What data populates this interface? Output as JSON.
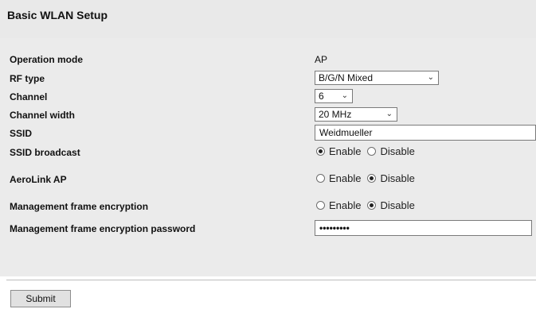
{
  "title": "Basic WLAN Setup",
  "fields": {
    "operation_mode": {
      "label": "Operation mode",
      "value": "AP"
    },
    "rf_type": {
      "label": "RF type",
      "value": "B/G/N Mixed"
    },
    "channel": {
      "label": "Channel",
      "value": "6"
    },
    "channel_width": {
      "label": "Channel width",
      "value": "20 MHz"
    },
    "ssid": {
      "label": "SSID",
      "value": "Weidmueller"
    },
    "ssid_broadcast": {
      "label": "SSID broadcast",
      "enable": "Enable",
      "disable": "Disable",
      "selected": "Enable"
    },
    "aerolink_ap": {
      "label": "AeroLink AP",
      "enable": "Enable",
      "disable": "Disable",
      "selected": "Disable"
    },
    "mgmt_frame_encryption": {
      "label": "Management frame encryption",
      "enable": "Enable",
      "disable": "Disable",
      "selected": "Disable"
    },
    "mgmt_frame_password": {
      "label": "Management frame encryption password",
      "value": "•••••••••"
    }
  },
  "submit_label": "Submit"
}
